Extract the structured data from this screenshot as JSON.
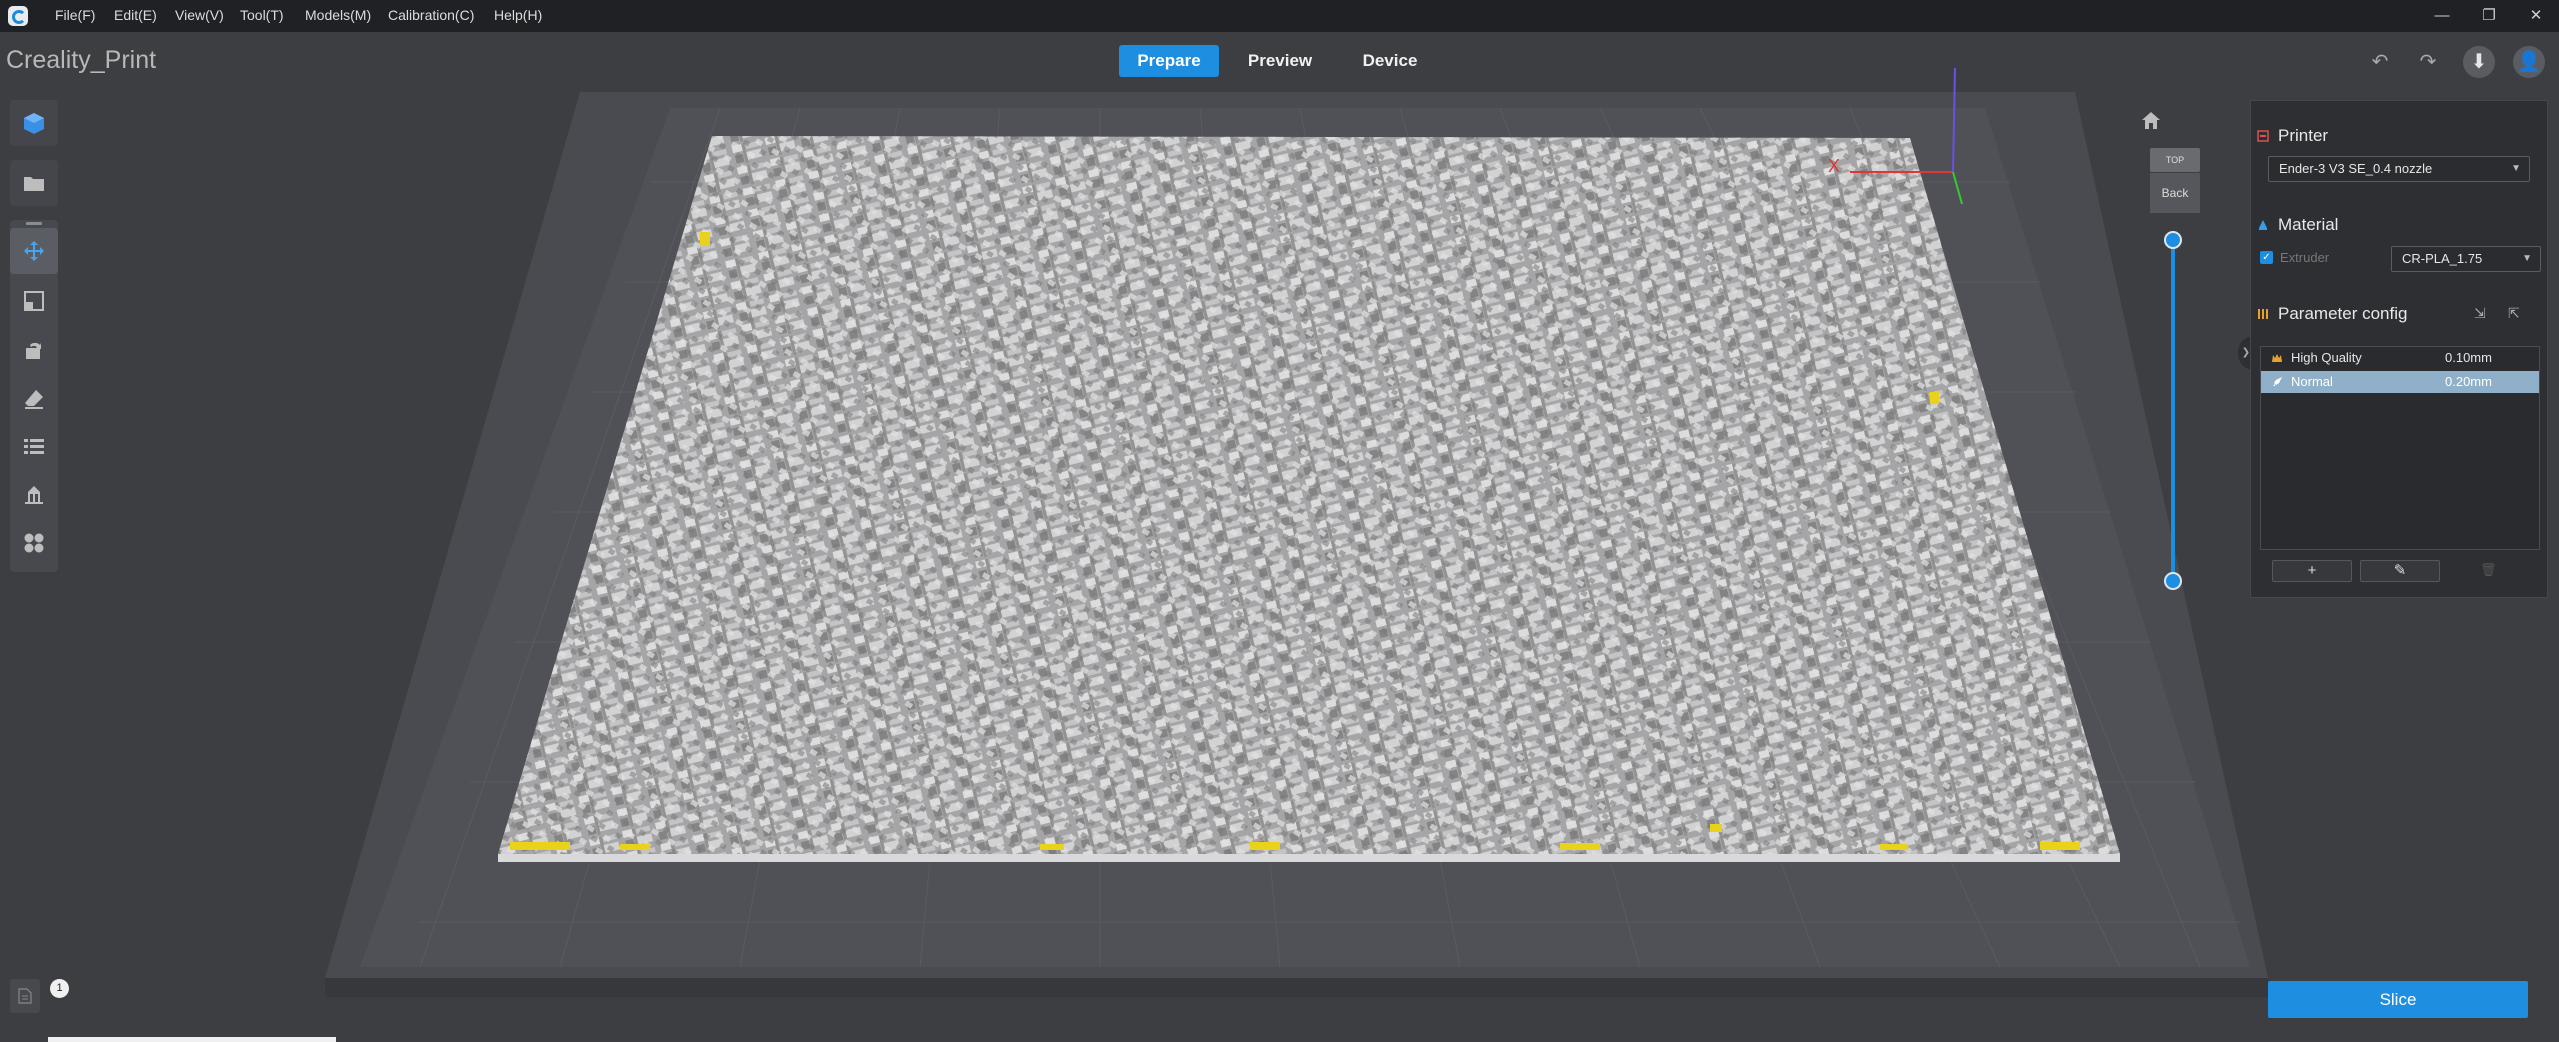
{
  "app": {
    "title": "Creality_Print"
  },
  "menu": {
    "items": [
      "File(F)",
      "Edit(E)",
      "View(V)",
      "Tool(T)",
      "Models(M)",
      "Calibration(C)",
      "Help(H)"
    ]
  },
  "window_controls": {
    "minimize": "—",
    "restore": "❐",
    "close": "✕"
  },
  "modes": {
    "prepare": "Prepare",
    "preview": "Preview",
    "device": "Device",
    "active": "Prepare"
  },
  "toolbar_right": {
    "undo": "↶",
    "redo": "↷",
    "download": "⬇",
    "account": "👤"
  },
  "left_tools": [
    "cube-icon",
    "open-folder-icon",
    "move-icon",
    "scale-icon",
    "rotate-icon",
    "paint-icon",
    "list-icon",
    "support-icon",
    "grid-icon"
  ],
  "view_cube": {
    "top": "TOP",
    "front": "Back"
  },
  "axes": {
    "x": "X",
    "x_color": "#e23636",
    "y_color": "#37c837",
    "z_color": "#6a4fe8"
  },
  "printer": {
    "section_title": "Printer",
    "selected": "Ender-3 V3 SE_0.4 nozzle"
  },
  "material": {
    "section_title": "Material",
    "extruder_label": "Extruder",
    "extruder_checked": true,
    "selected": "CR-PLA_1.75"
  },
  "parameter_config": {
    "section_title": "Parameter config",
    "profiles": [
      {
        "name": "High Quality",
        "value": "0.10mm",
        "selected": false
      },
      {
        "name": "Normal",
        "value": "0.20mm",
        "selected": true
      }
    ],
    "add_label": "+",
    "edit_label": "✎",
    "delete_label": "🗑"
  },
  "slice": {
    "label": "Slice"
  },
  "log": {
    "badge_count": "1"
  },
  "colors": {
    "accent": "#1d8ee0",
    "background": "#3d3e42",
    "panel": "#2e2f33",
    "menubar": "#202124"
  }
}
